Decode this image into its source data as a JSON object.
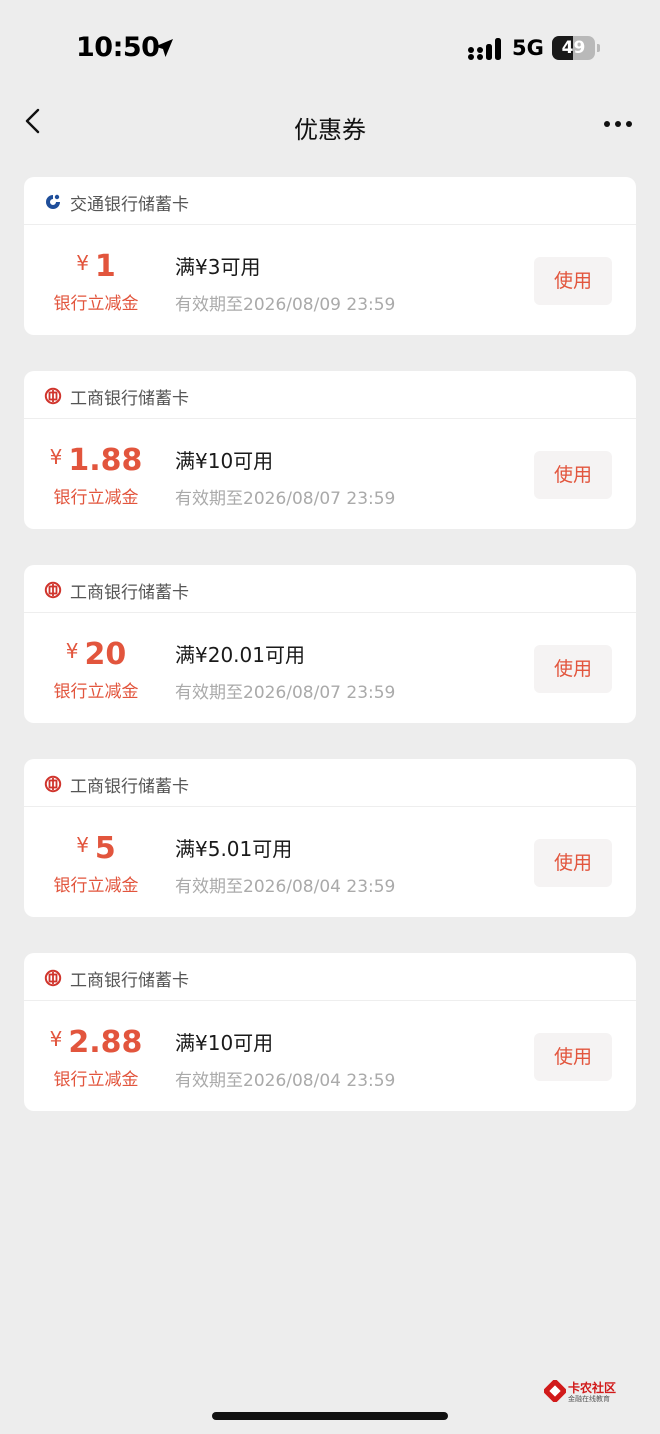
{
  "status_bar": {
    "time": "10:50",
    "location_icon": "location-arrow-icon",
    "signal_icon": "cellular-signal-icon",
    "network": "5G",
    "battery_level": "49",
    "battery_fraction": 0.49
  },
  "nav": {
    "back_icon": "chevron-left-icon",
    "title": "优惠券",
    "more_icon": "more-dots-icon"
  },
  "colors": {
    "accent": "#e2553d",
    "background": "#ededed",
    "card": "#ffffff",
    "bocom_blue": "#1f4e9a",
    "icbc_red": "#d0342c"
  },
  "coupons": [
    {
      "bank_icon": "bocom-logo-icon",
      "bank": "交通银行储蓄卡",
      "currency": "¥",
      "amount": "1",
      "type": "银行立减金",
      "threshold": "满¥3可用",
      "validity": "有效期至2026/08/09 23:59",
      "action": "使用"
    },
    {
      "bank_icon": "icbc-logo-icon",
      "bank": "工商银行储蓄卡",
      "currency": "¥",
      "amount": "1.88",
      "type": "银行立减金",
      "threshold": "满¥10可用",
      "validity": "有效期至2026/08/07 23:59",
      "action": "使用"
    },
    {
      "bank_icon": "icbc-logo-icon",
      "bank": "工商银行储蓄卡",
      "currency": "¥",
      "amount": "20",
      "type": "银行立减金",
      "threshold": "满¥20.01可用",
      "validity": "有效期至2026/08/07 23:59",
      "action": "使用"
    },
    {
      "bank_icon": "icbc-logo-icon",
      "bank": "工商银行储蓄卡",
      "currency": "¥",
      "amount": "5",
      "type": "银行立减金",
      "threshold": "满¥5.01可用",
      "validity": "有效期至2026/08/04 23:59",
      "action": "使用"
    },
    {
      "bank_icon": "icbc-logo-icon",
      "bank": "工商银行储蓄卡",
      "currency": "¥",
      "amount": "2.88",
      "type": "银行立减金",
      "threshold": "满¥10可用",
      "validity": "有效期至2026/08/04 23:59",
      "action": "使用"
    }
  ],
  "watermark": {
    "title": "卡农社区",
    "subtitle": "金融在线教育",
    "icon": "kanong-logo-icon"
  }
}
